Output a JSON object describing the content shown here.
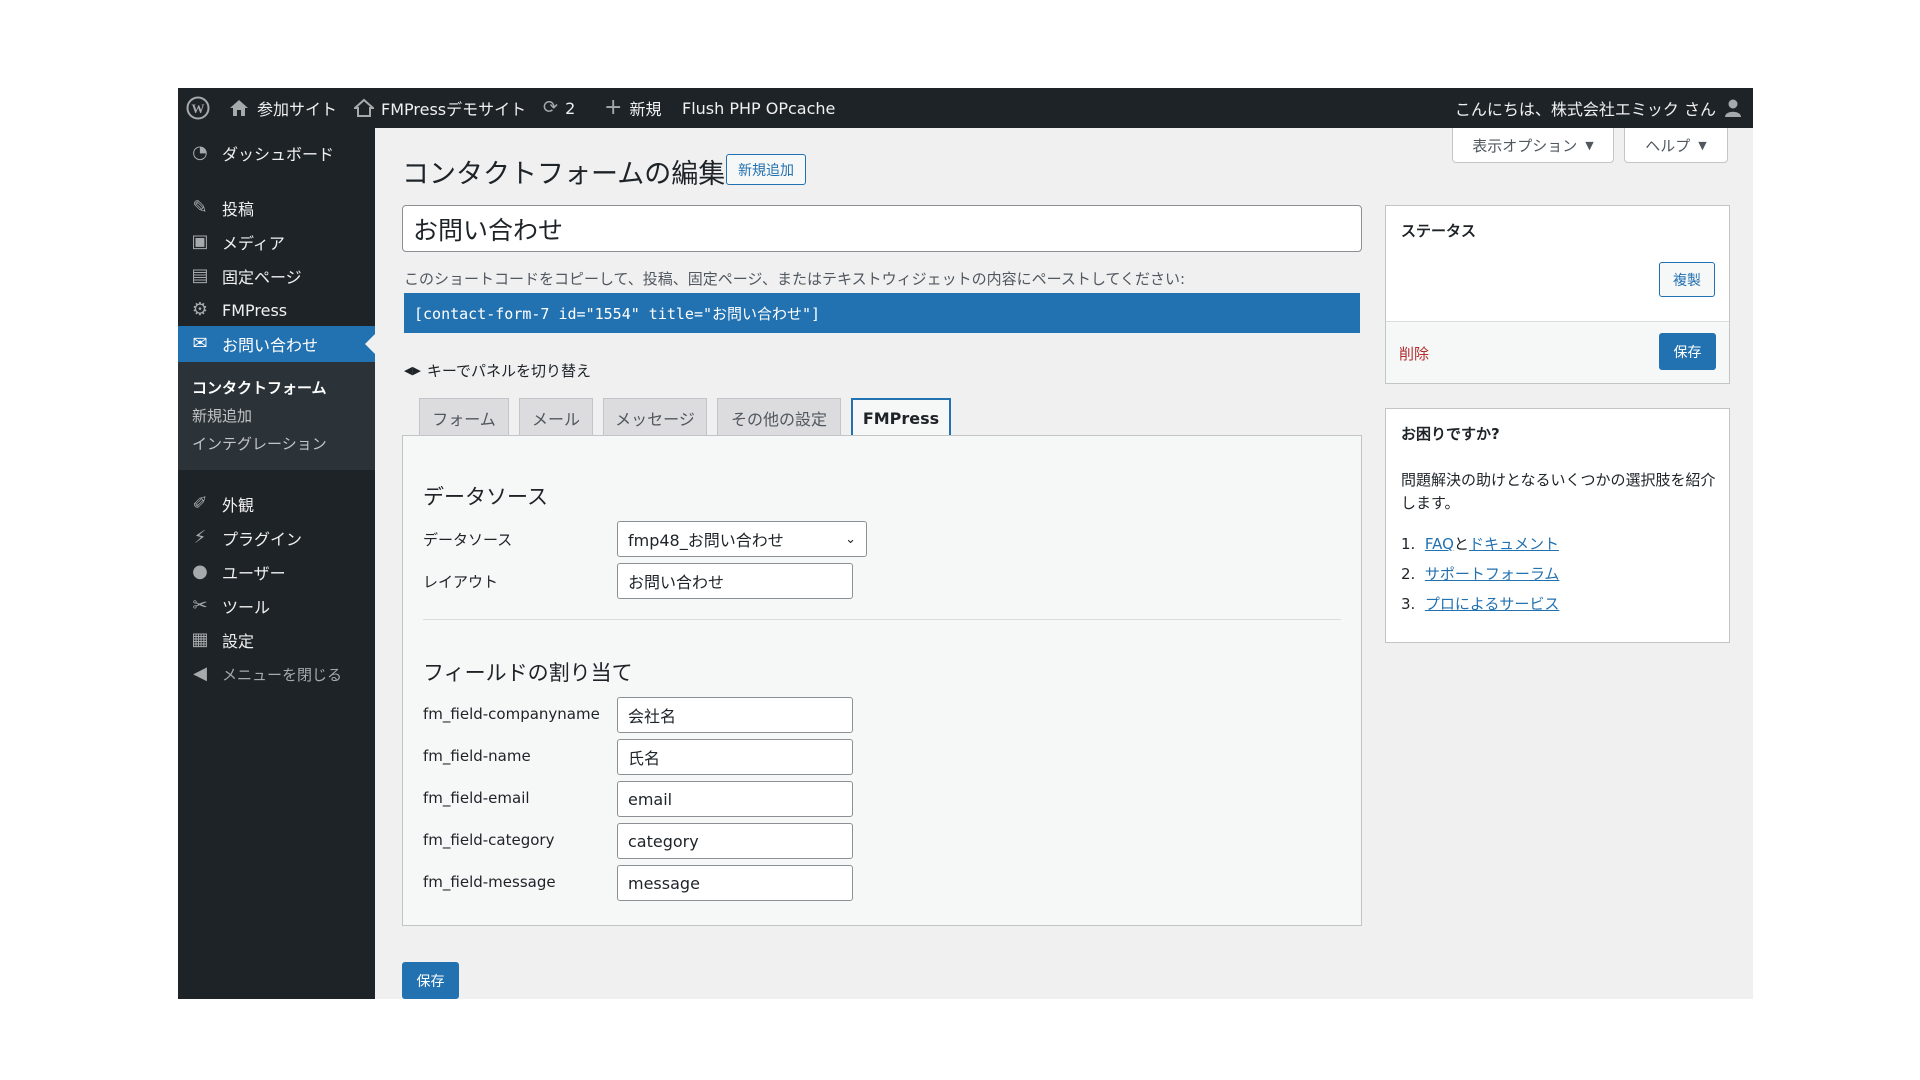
{
  "admin_bar": {
    "site_network": "参加サイト",
    "site_name": "FMPressデモサイト",
    "updates_count": "2",
    "new_label": "新規",
    "flush_label": "Flush PHP OPcache",
    "greeting": "こんにちは、株式会社エミック さん"
  },
  "screen_options": {
    "display_options": "表示オプション",
    "help": "ヘルプ"
  },
  "sidebar": {
    "items": [
      {
        "label": "ダッシュボード",
        "icon": "dashboard-icon"
      },
      {
        "label": "投稿",
        "icon": "pin-icon"
      },
      {
        "label": "メディア",
        "icon": "media-icon"
      },
      {
        "label": "固定ページ",
        "icon": "page-icon"
      },
      {
        "label": "FMPress",
        "icon": "gear-icon"
      },
      {
        "label": "お問い合わせ",
        "icon": "mail-icon"
      },
      {
        "label": "外観",
        "icon": "brush-icon"
      },
      {
        "label": "プラグイン",
        "icon": "plugin-icon"
      },
      {
        "label": "ユーザー",
        "icon": "user-icon"
      },
      {
        "label": "ツール",
        "icon": "wrench-icon"
      },
      {
        "label": "設定",
        "icon": "settings-icon"
      }
    ],
    "submenu": [
      "コンタクトフォーム",
      "新規追加",
      "インテグレーション"
    ],
    "collapse": "メニューを閉じる"
  },
  "page": {
    "title": "コンタクトフォームの編集",
    "add_new": "新規追加",
    "form_title": "お問い合わせ",
    "shortcode_note": "このショートコードをコピーして、投稿、固定ページ、またはテキストウィジェットの内容にペーストしてください:",
    "shortcode": "[contact-form-7 id=\"1554\" title=\"お問い合わせ\"]",
    "key_tip": "キーでパネルを切り替え",
    "save": "保存"
  },
  "tabs": [
    {
      "label": "フォーム"
    },
    {
      "label": "メール"
    },
    {
      "label": "メッセージ"
    },
    {
      "label": "その他の設定"
    },
    {
      "label": "FMPress",
      "active": true
    }
  ],
  "panel": {
    "datasource_heading": "データソース",
    "datasource_label": "データソース",
    "datasource_value": "fmp48_お問い合わせ",
    "layout_label": "レイアウト",
    "layout_value": "お問い合わせ",
    "mapping_heading": "フィールドの割り当て",
    "fields": [
      {
        "label": "fm_field-companyname",
        "value": "会社名"
      },
      {
        "label": "fm_field-name",
        "value": "氏名"
      },
      {
        "label": "fm_field-email",
        "value": "email"
      },
      {
        "label": "fm_field-category",
        "value": "category"
      },
      {
        "label": "fm_field-message",
        "value": "message"
      }
    ]
  },
  "status_box": {
    "title": "ステータス",
    "duplicate": "複製",
    "delete": "削除",
    "save": "保存"
  },
  "help_box": {
    "title": "お困りですか?",
    "text": "問題解決の助けとなるいくつかの選択肢を紹介します。",
    "items": [
      {
        "num": "1.",
        "link1": "FAQ",
        "sep": "と",
        "link2": "ドキュメント"
      },
      {
        "num": "2.",
        "link1": "サポートフォーラム"
      },
      {
        "num": "3.",
        "link1": "プロによるサービス"
      }
    ]
  },
  "colors": {
    "accent": "#2271b1",
    "admin_bar": "#1d2327",
    "delete": "#b32d2e"
  }
}
